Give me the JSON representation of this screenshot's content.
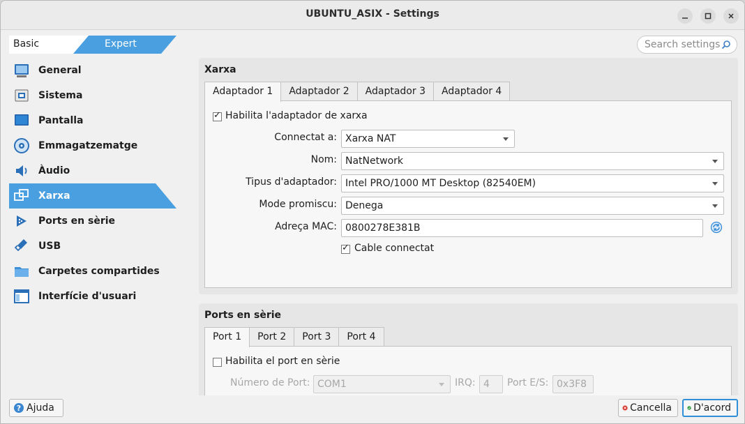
{
  "window": {
    "title": "UBUNTU_ASIX - Settings"
  },
  "mode_tabs": {
    "basic": "Basic",
    "expert": "Expert"
  },
  "search": {
    "placeholder": "Search settings"
  },
  "sidebar": {
    "items": [
      {
        "label": "General",
        "icon": "general-icon"
      },
      {
        "label": "Sistema",
        "icon": "system-chip-icon"
      },
      {
        "label": "Pantalla",
        "icon": "display-monitor-icon"
      },
      {
        "label": "Emmagatzematge",
        "icon": "storage-disk-icon"
      },
      {
        "label": "Àudio",
        "icon": "speaker-icon"
      },
      {
        "label": "Xarxa",
        "icon": "network-icon",
        "active": true
      },
      {
        "label": "Ports en sèrie",
        "icon": "serial-port-icon"
      },
      {
        "label": "USB",
        "icon": "usb-icon"
      },
      {
        "label": "Carpetes compartides",
        "icon": "folder-icon"
      },
      {
        "label": "Interfície d'usuari",
        "icon": "ui-window-icon"
      }
    ]
  },
  "network": {
    "title": "Xarxa",
    "tabs": [
      "Adaptador 1",
      "Adaptador 2",
      "Adaptador 3",
      "Adaptador 4"
    ],
    "active_tab": 0,
    "enable_label": "Habilita l'adaptador de xarxa",
    "enable_checked": true,
    "attached_label": "Connectat a:",
    "attached_value": "Xarxa NAT",
    "name_label": "Nom:",
    "name_value": "NatNetwork",
    "type_label": "Tipus d'adaptador:",
    "type_value": "Intel PRO/1000 MT Desktop (82540EM)",
    "promisc_label": "Mode promiscu:",
    "promisc_value": "Denega",
    "mac_label": "Adreça MAC:",
    "mac_value": "0800278E381B",
    "cable_label": "Cable connectat",
    "cable_checked": true
  },
  "serial": {
    "title": "Ports en sèrie",
    "tabs": [
      "Port 1",
      "Port 2",
      "Port 3",
      "Port 4"
    ],
    "active_tab": 0,
    "enable_label": "Habilita el port en sèrie",
    "enable_checked": false,
    "port_number_label": "Número de Port:",
    "port_number_value": "COM1",
    "irq_label": "IRQ:",
    "irq_value": "4",
    "io_label": "Port E/S:",
    "io_value": "0x3F8"
  },
  "footer": {
    "help": "Ajuda",
    "cancel": "Cancella",
    "ok": "D'acord"
  },
  "colors": {
    "accent": "#4a9fe0",
    "cancel_red": "#d9302c",
    "ok_green": "#2e9b3e"
  }
}
